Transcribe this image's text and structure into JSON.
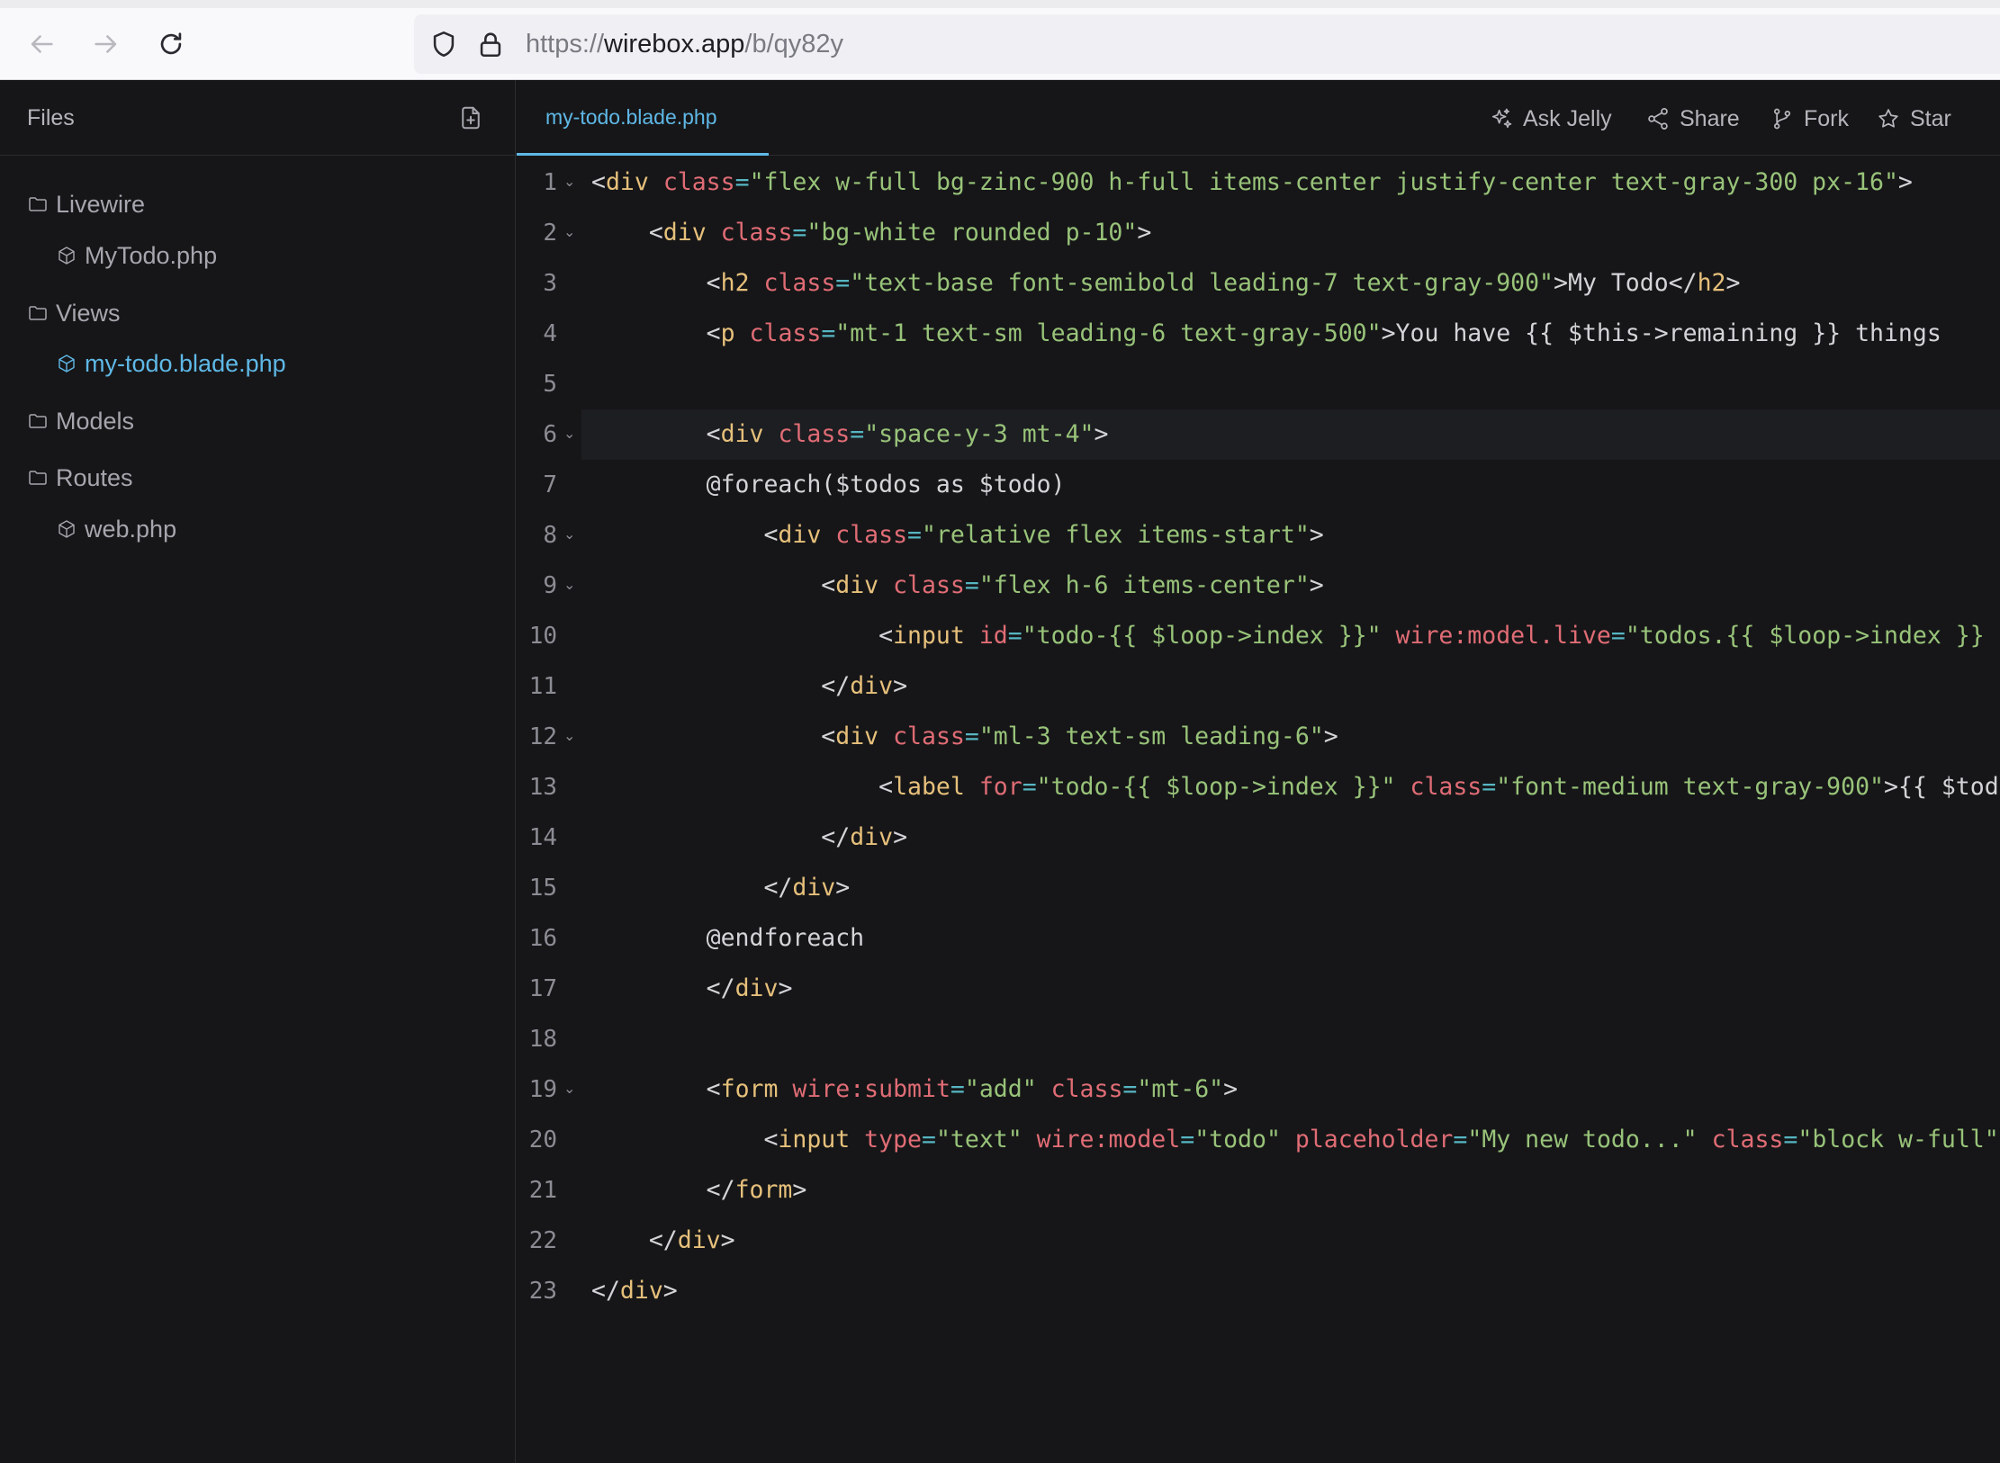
{
  "browser": {
    "url_scheme": "https://",
    "url_host": "wirebox.app",
    "url_path": "/b/qy82y"
  },
  "sidebar": {
    "title": "Files",
    "tree": [
      {
        "type": "folder",
        "label": "Livewire"
      },
      {
        "type": "file",
        "label": "MyTodo.php",
        "active": false
      },
      {
        "type": "folder",
        "label": "Views"
      },
      {
        "type": "file",
        "label": "my-todo.blade.php",
        "active": true
      },
      {
        "type": "folder",
        "label": "Models"
      },
      {
        "type": "folder",
        "label": "Routes"
      },
      {
        "type": "file",
        "label": "web.php",
        "active": false
      }
    ]
  },
  "editor": {
    "tab_label": "my-todo.blade.php",
    "actions": {
      "ask_jelly": "Ask Jelly",
      "share": "Share",
      "fork": "Fork",
      "star": "Star"
    },
    "current_line": 6,
    "lines": [
      {
        "n": "1",
        "fold": true,
        "tokens": [
          [
            "p",
            "<"
          ],
          [
            "tag",
            "div"
          ],
          [
            "t",
            " "
          ],
          [
            "attr",
            "class"
          ],
          [
            "eq",
            "="
          ],
          [
            "str",
            "\"flex w-full bg-zinc-900 h-full items-center justify-center text-gray-300 px-16\""
          ],
          [
            "p",
            ">"
          ]
        ]
      },
      {
        "n": "2",
        "fold": true,
        "tokens": [
          [
            "t",
            "    "
          ],
          [
            "p",
            "<"
          ],
          [
            "tag",
            "div"
          ],
          [
            "t",
            " "
          ],
          [
            "attr",
            "class"
          ],
          [
            "eq",
            "="
          ],
          [
            "str",
            "\"bg-white rounded p-10\""
          ],
          [
            "p",
            ">"
          ]
        ]
      },
      {
        "n": "3",
        "fold": false,
        "tokens": [
          [
            "t",
            "        "
          ],
          [
            "p",
            "<"
          ],
          [
            "tag",
            "h2"
          ],
          [
            "t",
            " "
          ],
          [
            "attr",
            "class"
          ],
          [
            "eq",
            "="
          ],
          [
            "str",
            "\"text-base font-semibold leading-7 text-gray-900\""
          ],
          [
            "p",
            ">"
          ],
          [
            "t",
            "My Todo"
          ],
          [
            "p",
            "</"
          ],
          [
            "tag",
            "h2"
          ],
          [
            "p",
            ">"
          ]
        ]
      },
      {
        "n": "4",
        "fold": false,
        "tokens": [
          [
            "t",
            "        "
          ],
          [
            "p",
            "<"
          ],
          [
            "tag",
            "p"
          ],
          [
            "t",
            " "
          ],
          [
            "attr",
            "class"
          ],
          [
            "eq",
            "="
          ],
          [
            "str",
            "\"mt-1 text-sm leading-6 text-gray-500\""
          ],
          [
            "p",
            ">"
          ],
          [
            "t",
            "You have {{ $this->remaining }} things"
          ]
        ]
      },
      {
        "n": "5",
        "fold": false,
        "tokens": []
      },
      {
        "n": "6",
        "fold": true,
        "tokens": [
          [
            "t",
            "        "
          ],
          [
            "p",
            "<"
          ],
          [
            "tag",
            "div"
          ],
          [
            "t",
            " "
          ],
          [
            "attr",
            "class"
          ],
          [
            "eq",
            "="
          ],
          [
            "str",
            "\"space-y-3 mt-4\""
          ],
          [
            "p",
            ">"
          ]
        ]
      },
      {
        "n": "7",
        "fold": false,
        "tokens": [
          [
            "t",
            "        @foreach($todos as $todo)"
          ]
        ]
      },
      {
        "n": "8",
        "fold": true,
        "tokens": [
          [
            "t",
            "            "
          ],
          [
            "p",
            "<"
          ],
          [
            "tag",
            "div"
          ],
          [
            "t",
            " "
          ],
          [
            "attr",
            "class"
          ],
          [
            "eq",
            "="
          ],
          [
            "str",
            "\"relative flex items-start\""
          ],
          [
            "p",
            ">"
          ]
        ]
      },
      {
        "n": "9",
        "fold": true,
        "tokens": [
          [
            "t",
            "                "
          ],
          [
            "p",
            "<"
          ],
          [
            "tag",
            "div"
          ],
          [
            "t",
            " "
          ],
          [
            "attr",
            "class"
          ],
          [
            "eq",
            "="
          ],
          [
            "str",
            "\"flex h-6 items-center\""
          ],
          [
            "p",
            ">"
          ]
        ]
      },
      {
        "n": "10",
        "fold": false,
        "tokens": [
          [
            "t",
            "                    "
          ],
          [
            "p",
            "<"
          ],
          [
            "tag",
            "input"
          ],
          [
            "t",
            " "
          ],
          [
            "attr",
            "id"
          ],
          [
            "eq",
            "="
          ],
          [
            "str",
            "\"todo-{{ $loop->index }}\""
          ],
          [
            "t",
            " "
          ],
          [
            "attr",
            "wire:model.live"
          ],
          [
            "eq",
            "="
          ],
          [
            "str",
            "\"todos.{{ $loop->index }}"
          ]
        ]
      },
      {
        "n": "11",
        "fold": false,
        "tokens": [
          [
            "t",
            "                "
          ],
          [
            "p",
            "</"
          ],
          [
            "tag",
            "div"
          ],
          [
            "p",
            ">"
          ]
        ]
      },
      {
        "n": "12",
        "fold": true,
        "tokens": [
          [
            "t",
            "                "
          ],
          [
            "p",
            "<"
          ],
          [
            "tag",
            "div"
          ],
          [
            "t",
            " "
          ],
          [
            "attr",
            "class"
          ],
          [
            "eq",
            "="
          ],
          [
            "str",
            "\"ml-3 text-sm leading-6\""
          ],
          [
            "p",
            ">"
          ]
        ]
      },
      {
        "n": "13",
        "fold": false,
        "tokens": [
          [
            "t",
            "                    "
          ],
          [
            "p",
            "<"
          ],
          [
            "tag",
            "label"
          ],
          [
            "t",
            " "
          ],
          [
            "attr",
            "for"
          ],
          [
            "eq",
            "="
          ],
          [
            "str",
            "\"todo-{{ $loop->index }}\""
          ],
          [
            "t",
            " "
          ],
          [
            "attr",
            "class"
          ],
          [
            "eq",
            "="
          ],
          [
            "str",
            "\"font-medium text-gray-900\""
          ],
          [
            "p",
            ">"
          ],
          [
            "t",
            "{{ $todo }}"
          ]
        ]
      },
      {
        "n": "14",
        "fold": false,
        "tokens": [
          [
            "t",
            "                "
          ],
          [
            "p",
            "</"
          ],
          [
            "tag",
            "div"
          ],
          [
            "p",
            ">"
          ]
        ]
      },
      {
        "n": "15",
        "fold": false,
        "tokens": [
          [
            "t",
            "            "
          ],
          [
            "p",
            "</"
          ],
          [
            "tag",
            "div"
          ],
          [
            "p",
            ">"
          ]
        ]
      },
      {
        "n": "16",
        "fold": false,
        "tokens": [
          [
            "t",
            "        @endforeach"
          ]
        ]
      },
      {
        "n": "17",
        "fold": false,
        "tokens": [
          [
            "t",
            "        "
          ],
          [
            "p",
            "</"
          ],
          [
            "tag",
            "div"
          ],
          [
            "p",
            ">"
          ]
        ]
      },
      {
        "n": "18",
        "fold": false,
        "tokens": []
      },
      {
        "n": "19",
        "fold": true,
        "tokens": [
          [
            "t",
            "        "
          ],
          [
            "p",
            "<"
          ],
          [
            "tag",
            "form"
          ],
          [
            "t",
            " "
          ],
          [
            "attr",
            "wire:submit"
          ],
          [
            "eq",
            "="
          ],
          [
            "str",
            "\"add\""
          ],
          [
            "t",
            " "
          ],
          [
            "attr",
            "class"
          ],
          [
            "eq",
            "="
          ],
          [
            "str",
            "\"mt-6\""
          ],
          [
            "p",
            ">"
          ]
        ]
      },
      {
        "n": "20",
        "fold": false,
        "tokens": [
          [
            "t",
            "            "
          ],
          [
            "p",
            "<"
          ],
          [
            "tag",
            "input"
          ],
          [
            "t",
            " "
          ],
          [
            "attr",
            "type"
          ],
          [
            "eq",
            "="
          ],
          [
            "str",
            "\"text\""
          ],
          [
            "t",
            " "
          ],
          [
            "attr",
            "wire:model"
          ],
          [
            "eq",
            "="
          ],
          [
            "str",
            "\"todo\""
          ],
          [
            "t",
            " "
          ],
          [
            "attr",
            "placeholder"
          ],
          [
            "eq",
            "="
          ],
          [
            "str",
            "\"My new todo...\""
          ],
          [
            "t",
            " "
          ],
          [
            "attr",
            "class"
          ],
          [
            "eq",
            "="
          ],
          [
            "str",
            "\"block w-full\""
          ]
        ]
      },
      {
        "n": "21",
        "fold": false,
        "tokens": [
          [
            "t",
            "        "
          ],
          [
            "p",
            "</"
          ],
          [
            "tag",
            "form"
          ],
          [
            "p",
            ">"
          ]
        ]
      },
      {
        "n": "22",
        "fold": false,
        "tokens": [
          [
            "t",
            "    "
          ],
          [
            "p",
            "</"
          ],
          [
            "tag",
            "div"
          ],
          [
            "p",
            ">"
          ]
        ]
      },
      {
        "n": "23",
        "fold": false,
        "tokens": [
          [
            "p",
            "</"
          ],
          [
            "tag",
            "div"
          ],
          [
            "p",
            ">"
          ]
        ]
      }
    ]
  }
}
